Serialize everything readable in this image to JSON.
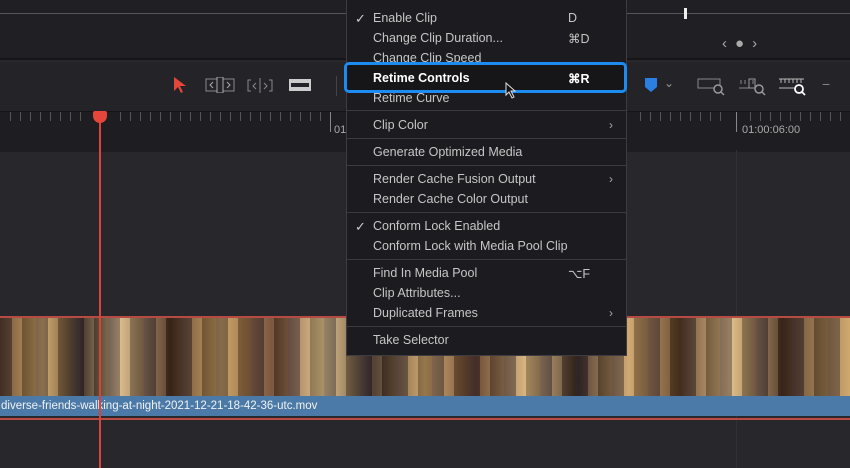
{
  "timeline": {
    "timecode_left": "01",
    "timecode_right": "01:00:06:00",
    "clip_name": "diverse-friends-walking-at-night-2021-12-21-18-42-36-utc.mov"
  },
  "nav": {
    "prev": "‹",
    "dot": "●",
    "next": "›"
  },
  "toolbar": {
    "select": "selection-tool",
    "trim": "trim-edit-tool",
    "dynamic_trim": "dynamic-trim-tool",
    "blade": "blade-tool",
    "flag": "flag",
    "zoom_full": "zoom-full",
    "zoom_detail": "zoom-detail",
    "zoom_custom": "zoom-custom",
    "minus": "−"
  },
  "menu": {
    "items": [
      {
        "label": "Enable Clip",
        "shortcut": "D",
        "checked": true
      },
      {
        "label": "Change Clip Duration...",
        "shortcut": "⌘D"
      },
      {
        "label": "Change Clip Speed"
      },
      {
        "label": "Retime Controls",
        "shortcut": "⌘R",
        "highlighted": true
      },
      {
        "label": "Retime Curve"
      },
      {
        "label": "Clip Color",
        "submenu": true
      },
      {
        "label": "Generate Optimized Media"
      },
      {
        "label": "Render Cache Fusion Output",
        "submenu": true
      },
      {
        "label": "Render Cache Color Output"
      },
      {
        "label": "Conform Lock Enabled",
        "checked": true
      },
      {
        "label": "Conform Lock with Media Pool Clip"
      },
      {
        "label": "Find In Media Pool",
        "shortcut": "⌥F"
      },
      {
        "label": "Clip Attributes..."
      },
      {
        "label": "Duplicated Frames",
        "submenu": true
      },
      {
        "label": "Take Selector"
      }
    ],
    "check": "✓",
    "arrow": "›"
  },
  "colors": {
    "accent": "#1c8cf0",
    "playhead": "#e5463b",
    "clip": "#4b7aa8"
  }
}
